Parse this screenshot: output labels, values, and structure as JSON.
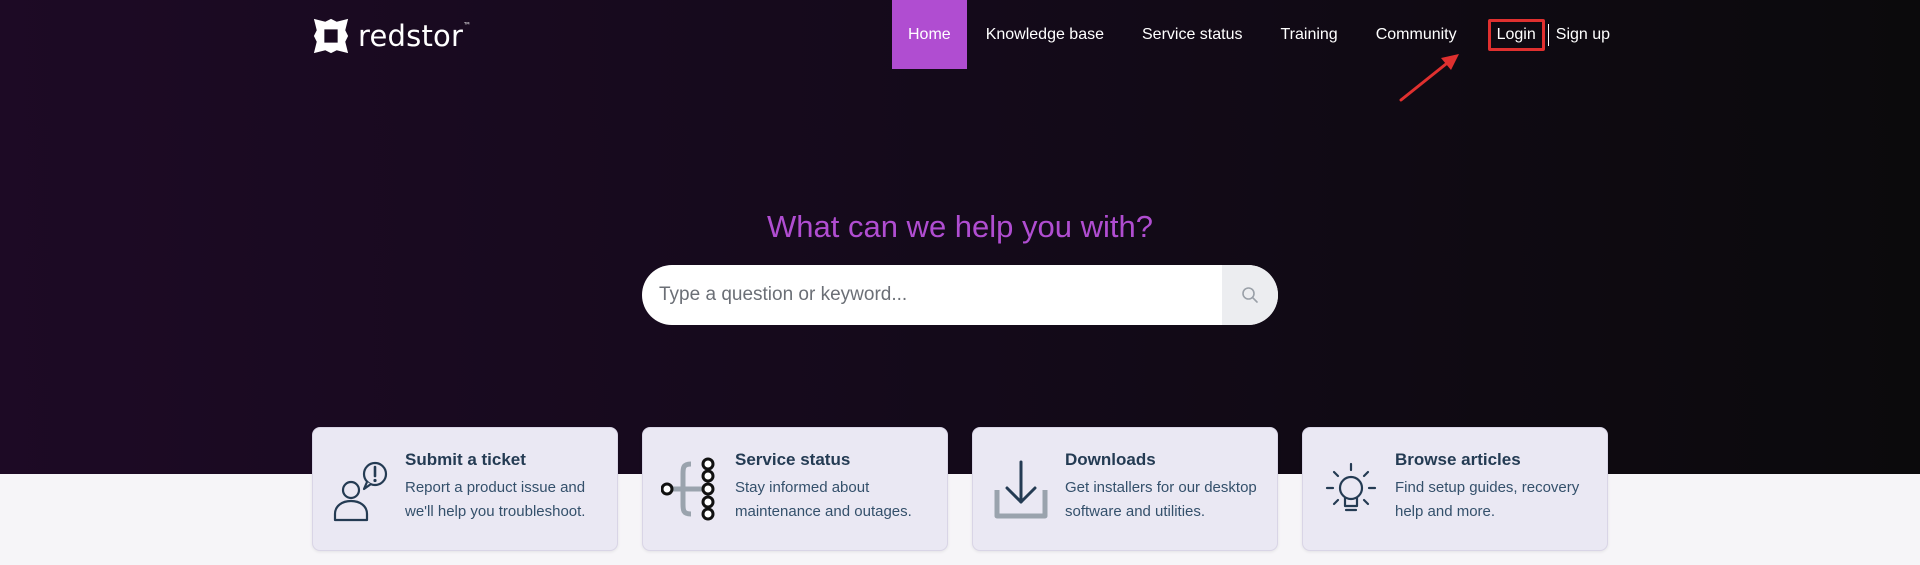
{
  "brand": {
    "name": "redstor",
    "trademark": "™",
    "icon": "redstor-logo-icon"
  },
  "nav": {
    "items": [
      {
        "label": "Home",
        "active": true
      },
      {
        "label": "Knowledge base"
      },
      {
        "label": "Service status"
      },
      {
        "label": "Training"
      },
      {
        "label": "Community"
      }
    ],
    "login_label": "Login",
    "signup_label": "Sign up"
  },
  "hero": {
    "headline": "What can we help you with?",
    "search_placeholder": "Type a question or keyword...",
    "search_icon": "search-icon"
  },
  "cards": [
    {
      "title": "Submit a ticket",
      "desc_line1": "Report a product issue and",
      "desc_line2": "we'll help you troubleshoot.",
      "icon": "user-alert-icon"
    },
    {
      "title": "Service status",
      "desc_line1": "Stay informed about",
      "desc_line2": "maintenance and outages.",
      "icon": "service-nodes-icon"
    },
    {
      "title": "Downloads",
      "desc_line1": "Get installers for our desktop",
      "desc_line2": "software and utilities.",
      "icon": "download-icon"
    },
    {
      "title": "Browse articles",
      "desc_line1": "Find setup guides, recovery",
      "desc_line2": "help and more.",
      "icon": "lightbulb-icon"
    }
  ],
  "colors": {
    "accent": "#b04dd1",
    "highlight": "#e0302f",
    "hero_bg": "#1d0a25",
    "card_bg": "#eae8f3",
    "card_title": "#243b53"
  }
}
